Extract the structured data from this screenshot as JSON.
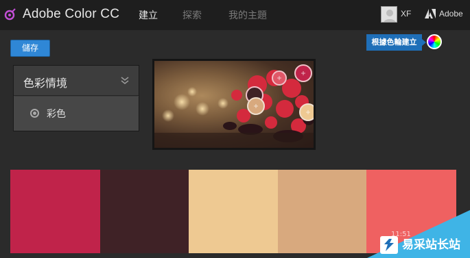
{
  "header": {
    "app_title": "Adobe Color CC",
    "tabs": [
      {
        "label": "建立",
        "active": true
      },
      {
        "label": "探索",
        "active": false
      },
      {
        "label": "我的主題",
        "active": false
      }
    ],
    "user_name": "XF",
    "adobe_label": "Adobe"
  },
  "toolbar": {
    "save_label": "儲存",
    "wheel_tooltip": "根據色輪建立"
  },
  "mood_panel": {
    "title": "色彩情境",
    "option_label": "彩色"
  },
  "palette": {
    "swatches": [
      {
        "color": "#c0234a"
      },
      {
        "color": "#3f2226"
      },
      {
        "color": "#eec992"
      },
      {
        "color": "#d8a97e"
      },
      {
        "color": "#ef6161"
      }
    ]
  },
  "watermark": {
    "text": "易采站长站",
    "time": "11:51"
  },
  "colors": {
    "accent": "#2f87d6",
    "topbar": "#1e1e1e",
    "background": "#2b2b2b"
  }
}
